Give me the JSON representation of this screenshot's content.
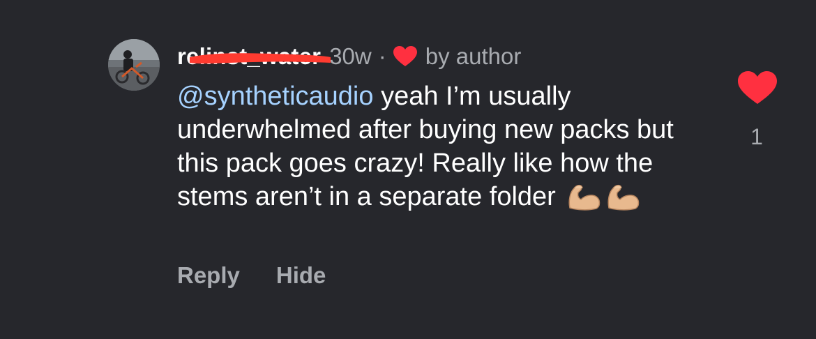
{
  "comment": {
    "username": "relinst_water",
    "time_ago": "30w",
    "separator": "·",
    "liked_by_label": "by author",
    "mention": "@syntheticaudio",
    "text": " yeah I’m usually underwhelmed after buying new packs but this pack goes crazy! Really like how the stems aren’t in a separate folder ",
    "emojis": "💪🏼💪🏼",
    "like_count": "1"
  },
  "actions": {
    "reply_label": "Reply",
    "hide_label": "Hide"
  },
  "colors": {
    "background": "#26272c",
    "mention": "#a6d2ff",
    "heart": "#ff3040",
    "secondary_text": "#a8abb0",
    "redaction": "#ff3b30"
  },
  "icons": {
    "author_like": "heart-icon",
    "like_button": "heart-icon",
    "emoji": "flexed-biceps-emoji"
  }
}
